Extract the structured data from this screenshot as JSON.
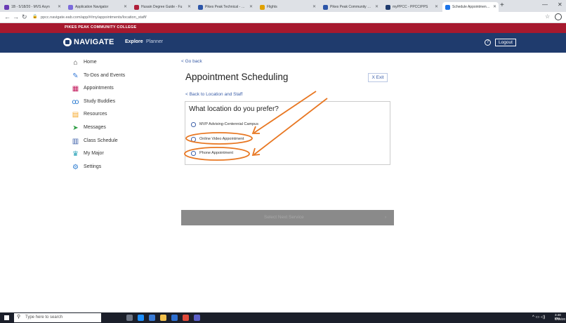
{
  "browser": {
    "tabs": [
      {
        "label": "1B - 5/18/20 - MVS Asyn",
        "color": "#6a3bb5",
        "active": false
      },
      {
        "label": "Application Navigator",
        "color": "#7a6adb",
        "active": false
      },
      {
        "label": "Husain Degree Guide - Fu",
        "color": "#b0203a",
        "active": false
      },
      {
        "label": "Pikes Peak Technical - Level I",
        "color": "#2c55a8",
        "active": false
      },
      {
        "label": "Flights",
        "color": "#e0a100",
        "active": false
      },
      {
        "label": "Pikes Peak Community Coll",
        "color": "#2c55a8",
        "active": false
      },
      {
        "label": "myPPCC - PPCC/PPS",
        "color": "#1f3b6d",
        "active": false
      },
      {
        "label": "Schedule Appointment | Na",
        "color": "#1a73e8",
        "active": true
      }
    ],
    "url": "ppcc.navigate.eab.com/app/#/my/appointments/location_staff/",
    "new_tab_symbol": "+"
  },
  "college_name": "PIKES PEAK COMMUNITY COLLEGE",
  "header": {
    "brand": "NAVIGATE",
    "nav_explore": "Explore",
    "nav_planner": "Planner",
    "help_symbol": "?",
    "logout": "Logout"
  },
  "sidebar": {
    "items": [
      {
        "label": "Home",
        "icon": "home-icon",
        "glyph": "⌂",
        "color": "#333333"
      },
      {
        "label": "To-Dos and Events",
        "icon": "todo-icon",
        "glyph": "✎",
        "color": "#3b7dd8"
      },
      {
        "label": "Appointments",
        "icon": "calendar-icon",
        "glyph": "▦",
        "color": "#c2185b"
      },
      {
        "label": "Study Buddies",
        "icon": "people-icon",
        "glyph": "ꝏ",
        "color": "#2e7dd1"
      },
      {
        "label": "Resources",
        "icon": "resources-icon",
        "glyph": "▤",
        "color": "#f5a623"
      },
      {
        "label": "Messages",
        "icon": "send-icon",
        "glyph": "➤",
        "color": "#2e9e44"
      },
      {
        "label": "Class Schedule",
        "icon": "schedule-icon",
        "glyph": "▥",
        "color": "#3b5ea8"
      },
      {
        "label": "My Major",
        "icon": "graduation-cap-icon",
        "glyph": "♛",
        "color": "#2aa3b8"
      },
      {
        "label": "Settings",
        "icon": "gear-icon",
        "glyph": "⚙",
        "color": "#2e7dd1"
      }
    ]
  },
  "main": {
    "go_back": "< Go back",
    "title": "Appointment Scheduling",
    "exit": "X Exit",
    "back_to_location": "< Back to Location and Staff",
    "question": "What location do you prefer?",
    "options": [
      {
        "label": "MVP Advising-Centennial Campus"
      },
      {
        "label": "Online Video Appointment"
      },
      {
        "label": "Phone Appointment"
      }
    ],
    "select_button": "Select Next Service",
    "select_arrow": "›"
  },
  "annotation_color": "#e87722",
  "taskbar": {
    "search_placeholder": "Type here to search",
    "time": "3:48 PM",
    "date": "5/18/20"
  }
}
